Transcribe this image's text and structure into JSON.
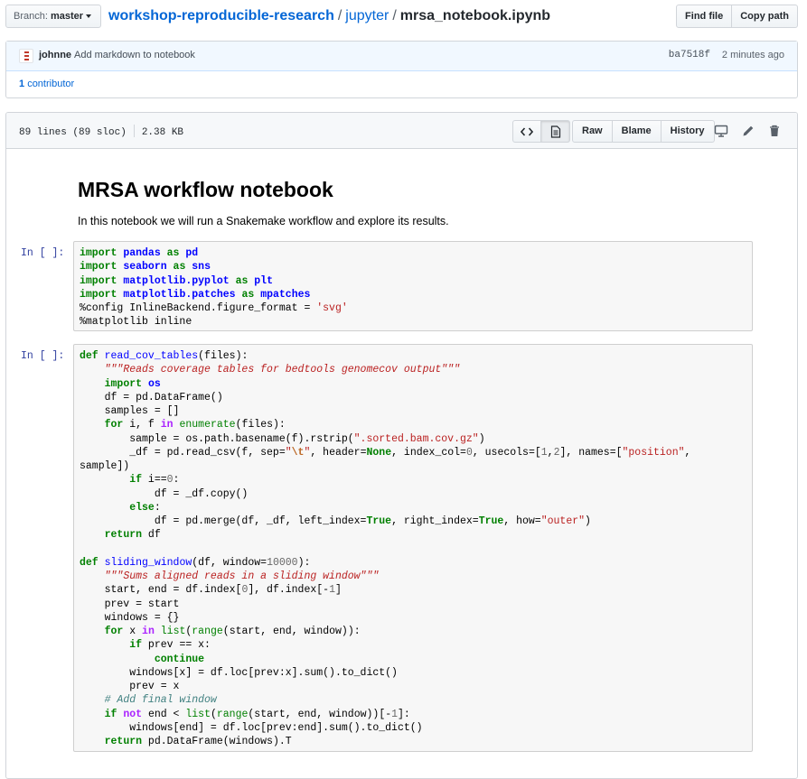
{
  "topbar": {
    "branch_label": "Branch:",
    "branch_value": "master",
    "repo": "workshop-reproducible-research",
    "sep1": "/",
    "folder": "jupyter",
    "sep2": "/",
    "file": "mrsa_notebook.ipynb",
    "find_file": "Find file",
    "copy_path": "Copy path"
  },
  "commit": {
    "author": "johnne",
    "message": "Add markdown to notebook",
    "sha": "ba7518f",
    "time": "2 minutes ago",
    "contributors_count": "1",
    "contributors_label": "contributor"
  },
  "file_header": {
    "lines": "89 lines (89 sloc)",
    "size": "2.38 KB",
    "raw": "Raw",
    "blame": "Blame",
    "history": "History",
    "icons": [
      "code-view-icon",
      "document-view-icon",
      "desktop-icon",
      "pencil-icon",
      "trash-icon"
    ]
  },
  "notebook": {
    "title": "MRSA workflow notebook",
    "intro": "In this notebook we will run a Snakemake workflow and explore its results.",
    "prompt1": "In [ ]:",
    "prompt2": "In [ ]:"
  },
  "colors": {
    "link": "#0366d6",
    "prompt": "#303f9f",
    "keyword": "#008000",
    "namespace": "#0000ff",
    "string": "#ba2121"
  }
}
